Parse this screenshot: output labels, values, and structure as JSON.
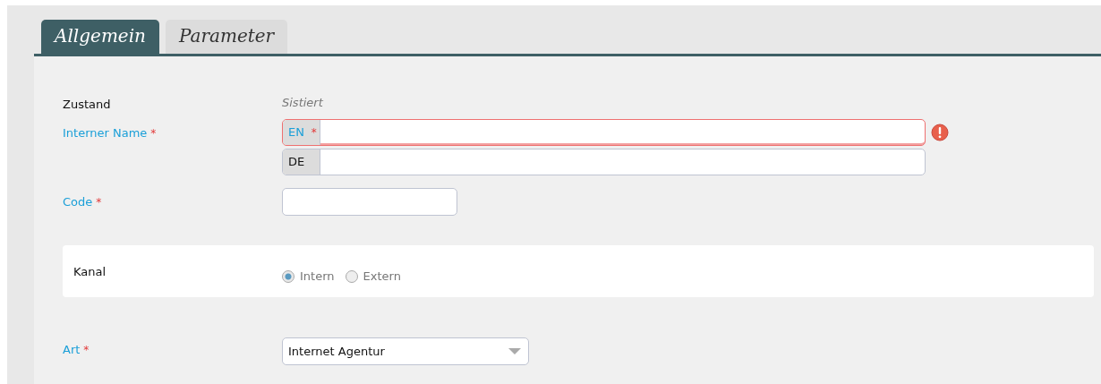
{
  "tabs": [
    {
      "label": "Allgemein",
      "selected": true
    },
    {
      "label": "Parameter",
      "selected": false
    }
  ],
  "fields": [
    {
      "kind": "text",
      "label": "Zustand",
      "required": false,
      "value": "Sistiert"
    },
    {
      "kind": "i18n",
      "label": "Interner Name",
      "required": true,
      "mark": "*",
      "error": true,
      "languages": [
        {
          "code": "EN",
          "required": true,
          "mark": "*",
          "invalid": true
        },
        {
          "code": "DE",
          "required": false,
          "invalid": false
        }
      ]
    },
    {
      "kind": "input",
      "label": "Code",
      "required": true,
      "mark": "*"
    },
    {
      "kind": "radio",
      "label": "Kanal",
      "required": false,
      "options": [
        {
          "label": "Intern",
          "selected": true
        },
        {
          "label": "Extern",
          "selected": false
        }
      ]
    },
    {
      "kind": "select",
      "label": "Art",
      "required": true,
      "mark": "*",
      "value": "Internet Agentur"
    }
  ]
}
